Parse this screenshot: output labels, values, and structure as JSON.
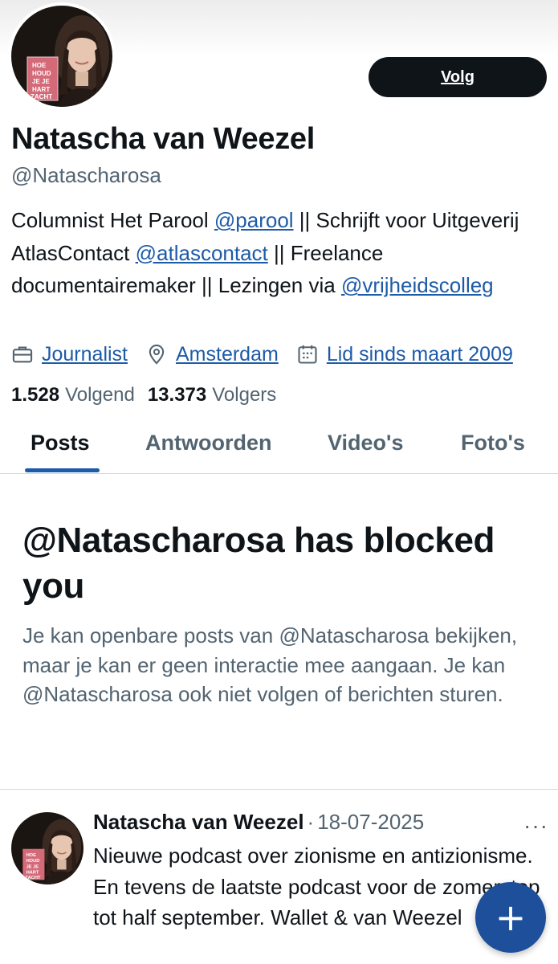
{
  "profile": {
    "name": "Natascha van Weezel",
    "handle": "@Natascharosa",
    "follow_label": "Volg",
    "avatar_book_text": [
      "HOE",
      "HOUD",
      "JE JE",
      "HART",
      "ZACHT"
    ],
    "bio": {
      "text_1": "Columnist Het Parool ",
      "mention_1": "@parool",
      "text_2": " || Schrijft voor Uitgeverij AtlasContact ",
      "mention_2": "@atlascontact",
      "text_3": " || Freelance documentairemaker || Lezingen via ",
      "mention_3": "@vrijheidscolleg"
    },
    "meta": {
      "profession_icon": "briefcase-icon",
      "profession": "Journalist",
      "location_icon": "location-pin-icon",
      "location": "Amsterdam",
      "joined_icon": "calendar-icon",
      "joined": "Lid sinds maart 2009"
    },
    "stats": {
      "following_count": "1.528",
      "following_label": "Volgend",
      "followers_count": "13.373",
      "followers_label": "Volgers"
    }
  },
  "tabs": [
    {
      "label": "Posts",
      "active": true
    },
    {
      "label": "Antwoorden",
      "active": false
    },
    {
      "label": "Video's",
      "active": false
    },
    {
      "label": "Foto's",
      "active": false
    }
  ],
  "blocked": {
    "title": "@Natascharosa has blocked you",
    "description": "Je kan openbare posts van @Natascharosa bekijken, maar je kan er geen interactie mee aangaan. Je kan @Natascharosa ook niet volgen of berichten sturen."
  },
  "post": {
    "author": "Natascha van Weezel",
    "separator": "·",
    "date": "18-07-2025",
    "more_label": "···",
    "text": "Nieuwe podcast over zionisme en antizionisme. En tevens de laatste podcast voor de zomerstop tot half september. Wallet & van Weezel"
  },
  "fab": {
    "label": "+",
    "icon": "plus-icon"
  },
  "colors": {
    "text_primary": "#0f1419",
    "text_secondary": "#536471",
    "link": "#1d5ba8",
    "button_dark": "#0f1419",
    "fab": "#1d4f9a",
    "divider": "#cfd9de"
  }
}
